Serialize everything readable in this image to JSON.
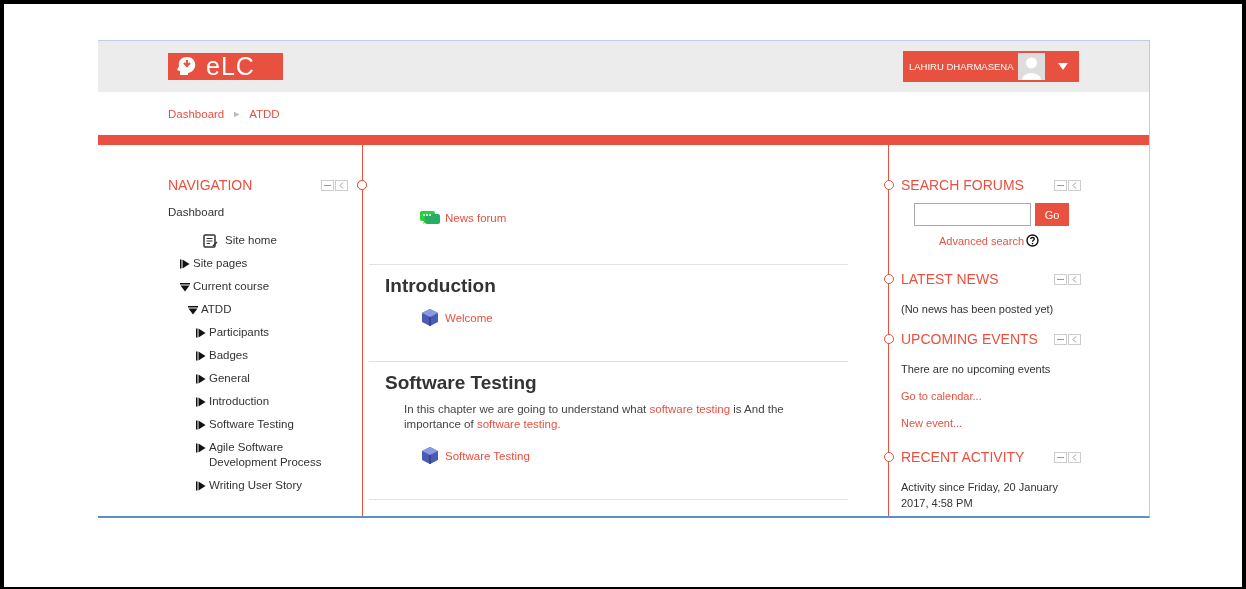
{
  "header": {
    "logo": "eLC",
    "user": {
      "name": "LAHIRU DHARMASENA"
    }
  },
  "breadcrumb": {
    "separator": "►",
    "items": [
      {
        "label": "Dashboard"
      },
      {
        "label": "ATDD"
      }
    ]
  },
  "navigation": {
    "title": "NAVIGATION",
    "items": [
      {
        "label": "Dashboard",
        "kind": "root",
        "children": [
          {
            "label": "Site home",
            "kind": "page"
          },
          {
            "label": "Site pages",
            "kind": "branch",
            "expanded": false
          },
          {
            "label": "Current course",
            "kind": "branch",
            "expanded": true,
            "children": [
              {
                "label": "ATDD",
                "kind": "branch",
                "expanded": true,
                "children": [
                  {
                    "label": "Participants",
                    "kind": "branch",
                    "expanded": false
                  },
                  {
                    "label": "Badges",
                    "kind": "branch",
                    "expanded": false
                  },
                  {
                    "label": "General",
                    "kind": "branch",
                    "expanded": false
                  },
                  {
                    "label": "Introduction",
                    "kind": "branch",
                    "expanded": false
                  },
                  {
                    "label": "Software Testing",
                    "kind": "branch",
                    "expanded": false
                  },
                  {
                    "label": "Agile Software Development Process",
                    "kind": "branch",
                    "expanded": false
                  },
                  {
                    "label": "Writing User Story",
                    "kind": "branch",
                    "expanded": false
                  }
                ]
              }
            ]
          }
        ]
      }
    ]
  },
  "sections": [
    {
      "activities": [
        {
          "label": "News forum",
          "kind": "forum"
        }
      ]
    },
    {
      "title": "Introduction",
      "activities": [
        {
          "label": "Welcome",
          "kind": "resource"
        }
      ]
    },
    {
      "title": "Software Testing",
      "summary": [
        {
          "text": "In this chapter we are going to understand what ",
          "link": false
        },
        {
          "text": "software testing",
          "link": true
        },
        {
          "text": " is And the importance of ",
          "link": false
        },
        {
          "text": "software testing.",
          "link": true
        }
      ],
      "activities": [
        {
          "label": "Software Testing",
          "kind": "resource"
        }
      ]
    }
  ],
  "blocks": [
    {
      "title": "SEARCH FORUMS",
      "kind": "search",
      "button": "Go",
      "link": "Advanced search"
    },
    {
      "title": "LATEST NEWS",
      "kind": "text",
      "lines": [
        {
          "text": "(No news has been posted yet)",
          "link": false
        }
      ]
    },
    {
      "title": "UPCOMING EVENTS",
      "kind": "text",
      "lines": [
        {
          "text": "There are no upcoming events",
          "link": false
        },
        {
          "text": "Go to calendar...",
          "link": true
        },
        {
          "text": "New event...",
          "link": true
        }
      ]
    },
    {
      "title": "RECENT ACTIVITY",
      "kind": "text",
      "lines": [
        {
          "text": "Activity since Friday, 20 January 2017, 4:58 PM",
          "link": false
        }
      ]
    }
  ]
}
